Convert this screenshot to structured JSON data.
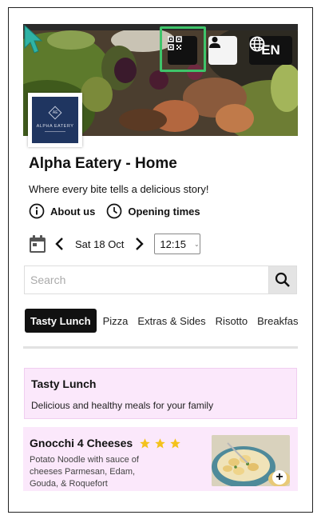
{
  "header": {
    "lang_label": "EN"
  },
  "restaurant": {
    "logo_name": "ALPHA EATERY",
    "logo_mark": "AE",
    "title": "Alpha Eatery - Home",
    "tagline": "Where every bite tells a delicious story!"
  },
  "info": {
    "about_label": "About us",
    "opening_label": "Opening times"
  },
  "schedule": {
    "date": "Sat 18 Oct",
    "time": "12:15"
  },
  "search": {
    "placeholder": "Search"
  },
  "tabs": [
    {
      "label": "Tasty Lunch",
      "active": true
    },
    {
      "label": "Pizza"
    },
    {
      "label": "Extras & Sides"
    },
    {
      "label": "Risotto"
    },
    {
      "label": "Breakfast"
    }
  ],
  "category": {
    "title": "Tasty Lunch",
    "description": "Delicious and healthy meals for your family"
  },
  "menu_item": {
    "name": "Gnocchi 4 Cheeses",
    "rating": 3,
    "description": "Potato Noodle with sauce of cheeses Parmesan, Edam, Gouda, & Roquefort"
  },
  "colors": {
    "highlight": "#3fc46a",
    "cursor": "#2fb3a5",
    "card_bg": "#fbe8fb",
    "star": "#f4c21b"
  }
}
